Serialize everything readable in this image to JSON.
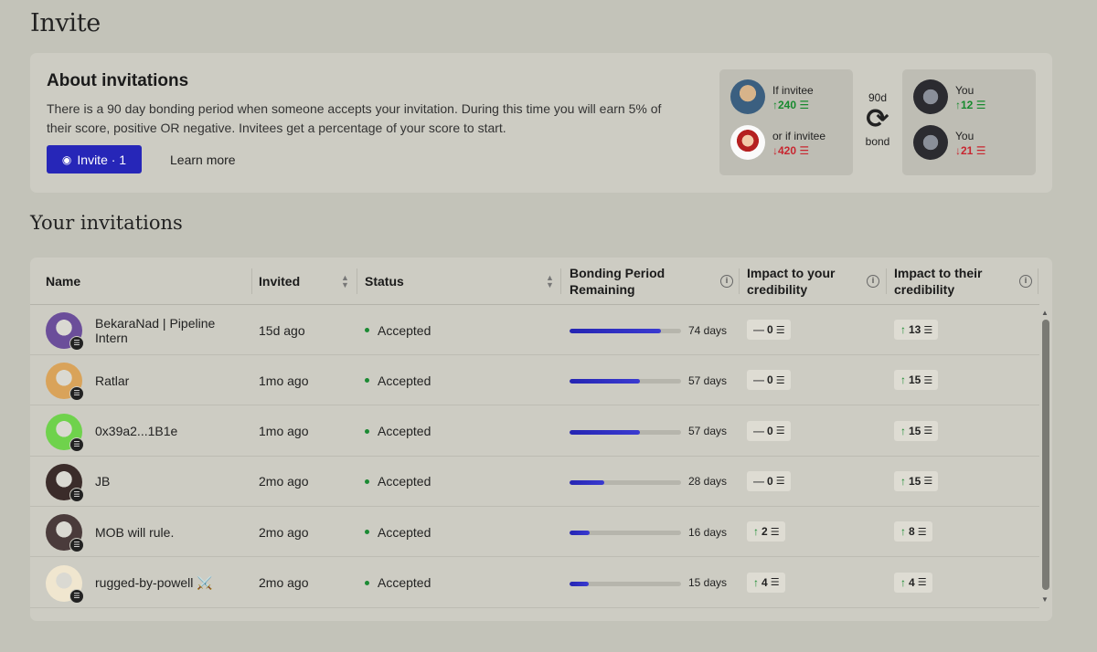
{
  "page": {
    "title": "Invite"
  },
  "about": {
    "title": "About invitations",
    "text": "There is a 90 day bonding period when someone accepts your invitation. During this time you will earn 5% of their score, positive OR negative. Invitees get a percentage of your score to start.",
    "invite_button": "Invite · 1",
    "learn_more": "Learn more",
    "bond": {
      "left": [
        {
          "label": "If invitee",
          "value": "↑240",
          "direction": "up"
        },
        {
          "label": "or if invitee",
          "value": "↓420",
          "direction": "down"
        }
      ],
      "mid_top": "90d",
      "mid_bottom": "bond",
      "right": [
        {
          "label": "You",
          "value": "↑12",
          "direction": "up"
        },
        {
          "label": "You",
          "value": "↓21",
          "direction": "down"
        }
      ]
    }
  },
  "invitations": {
    "title": "Your invitations",
    "columns": {
      "name": "Name",
      "invited": "Invited",
      "status": "Status",
      "bonding": "Bonding Period Remaining",
      "impact_yours": "Impact to your credibility",
      "impact_theirs": "Impact to their credibility"
    },
    "rows": [
      {
        "name": "BekaraNad | Pipeline Intern",
        "invited": "15d ago",
        "status": "Accepted",
        "progress": 0.82,
        "days": "74 days",
        "yours": "0",
        "yours_dir": "flat",
        "theirs": "13",
        "theirs_dir": "up",
        "avatar_color": "#6b4e9a"
      },
      {
        "name": "Ratlar",
        "invited": "1mo ago",
        "status": "Accepted",
        "progress": 0.63,
        "days": "57 days",
        "yours": "0",
        "yours_dir": "flat",
        "theirs": "15",
        "theirs_dir": "up",
        "avatar_color": "#d9a35a"
      },
      {
        "name": "0x39a2...1B1e",
        "invited": "1mo ago",
        "status": "Accepted",
        "progress": 0.63,
        "days": "57 days",
        "yours": "0",
        "yours_dir": "flat",
        "theirs": "15",
        "theirs_dir": "up",
        "avatar_color": "#6fd24c"
      },
      {
        "name": "JB",
        "invited": "2mo ago",
        "status": "Accepted",
        "progress": 0.31,
        "days": "28 days",
        "yours": "0",
        "yours_dir": "flat",
        "theirs": "15",
        "theirs_dir": "up",
        "avatar_color": "#3b2c2a"
      },
      {
        "name": "MOB will rule.",
        "invited": "2mo ago",
        "status": "Accepted",
        "progress": 0.18,
        "days": "16 days",
        "yours": "2",
        "yours_dir": "up",
        "theirs": "8",
        "theirs_dir": "up",
        "avatar_color": "#4a3b3b"
      },
      {
        "name": "rugged-by-powell ⚔️",
        "invited": "2mo ago",
        "status": "Accepted",
        "progress": 0.17,
        "days": "15 days",
        "yours": "4",
        "yours_dir": "up",
        "theirs": "4",
        "theirs_dir": "up",
        "avatar_color": "#f0e6cf"
      }
    ]
  },
  "colors": {
    "accent": "#2626b8",
    "up": "#178a2e",
    "down": "#c82630",
    "status_dot": "#1c8a34"
  }
}
